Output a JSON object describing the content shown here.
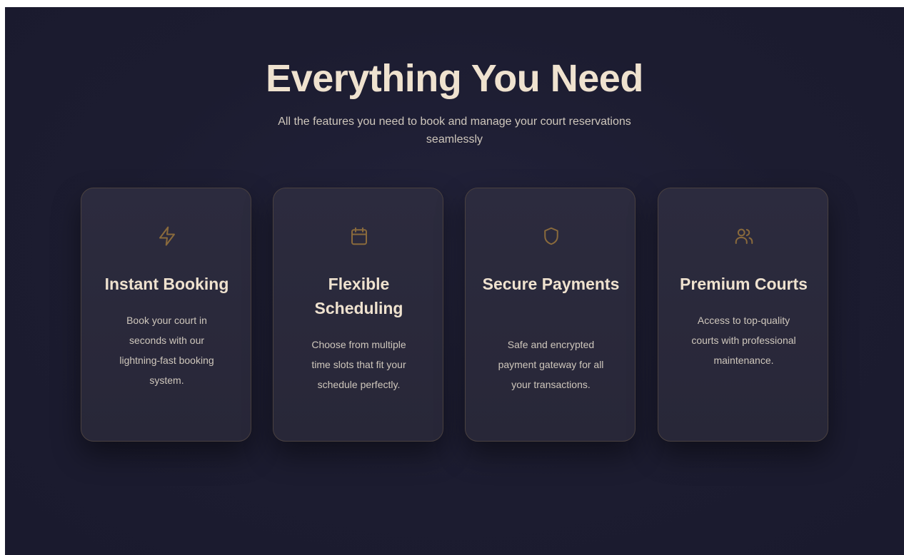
{
  "header": {
    "title": "Everything You Need",
    "subtitle": "All the features you need to book and manage your court reservations seamlessly"
  },
  "accent_color": "#8a6a3c",
  "features": [
    {
      "icon": "lightning-bolt-icon",
      "title": "Instant Booking",
      "description": "Book your court in seconds with our lightning-fast booking system."
    },
    {
      "icon": "calendar-icon",
      "title": "Flexible Scheduling",
      "description": "Choose from multiple time slots that fit your schedule perfectly."
    },
    {
      "icon": "shield-icon",
      "title": "Secure Payments",
      "description": "Safe and encrypted payment gateway for all your transactions."
    },
    {
      "icon": "users-icon",
      "title": "Premium Courts",
      "description": "Access to top-quality courts with professional maintenance."
    }
  ]
}
